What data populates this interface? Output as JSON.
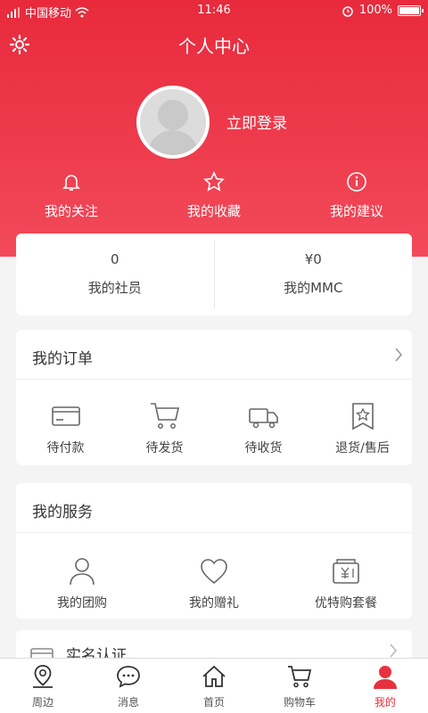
{
  "status_bar": {
    "carrier": "中国移动",
    "time": "11:46",
    "battery": "100%"
  },
  "header": {
    "title": "个人中心"
  },
  "profile": {
    "login_label": "立即登录"
  },
  "quick_links": [
    {
      "label": "我的关注",
      "icon": "bell-icon"
    },
    {
      "label": "我的收藏",
      "icon": "star-icon"
    },
    {
      "label": "我的建议",
      "icon": "info-icon"
    }
  ],
  "stats": [
    {
      "value": "0",
      "label": "我的社员"
    },
    {
      "value": "¥0",
      "label": "我的MMC"
    }
  ],
  "orders": {
    "title": "我的订单",
    "items": [
      {
        "label": "待付款",
        "icon": "card-icon"
      },
      {
        "label": "待发货",
        "icon": "cart-icon"
      },
      {
        "label": "待收货",
        "icon": "truck-icon"
      },
      {
        "label": "退货/售后",
        "icon": "return-star-icon"
      }
    ]
  },
  "services": {
    "title": "我的服务",
    "items": [
      {
        "label": "我的团购",
        "icon": "person-icon"
      },
      {
        "label": "我的赠礼",
        "icon": "heart-icon"
      },
      {
        "label": "优特购套餐",
        "icon": "wallet-yen-icon"
      }
    ]
  },
  "verify": {
    "label": "实名认证"
  },
  "tabbar": [
    {
      "label": "周边",
      "icon": "location-icon",
      "active": false
    },
    {
      "label": "消息",
      "icon": "chat-icon",
      "active": false
    },
    {
      "label": "首页",
      "icon": "home-icon",
      "active": false
    },
    {
      "label": "购物车",
      "icon": "cart-icon",
      "active": false
    },
    {
      "label": "我的",
      "icon": "user-icon",
      "active": true
    }
  ],
  "colors": {
    "accent": "#e8313f",
    "header_gradient_top": "#e82a3c"
  }
}
